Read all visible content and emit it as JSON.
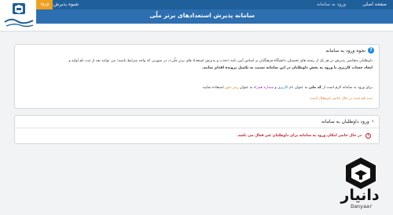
{
  "header": {
    "system_title": "سامانه پذیرش استعدادهای برتر ملّی",
    "nav": {
      "home": "صفحه اصلی",
      "register": "شیوه پذیرش",
      "other": "ورود به سامانه",
      "login": "ورود"
    }
  },
  "card1": {
    "title": "نحوه ورود به سامانه",
    "line1": "داوطلبان متقاضی پذیرش در هر یک از رشته های تحصیلی  دانشگاه فرهنگیان  بر اساس آیین نامه «جذب و پذیرش استعداد های برتر ملّی»، در صورتی که واجد شرایط باشند؛ می توانند بعد از ثبت نام  اولیه و",
    "line2": "ایجاد حساب کاربری با ورود به بخش داوطلبان در این سامانه نسبت به تکمیل پرونده اقدام نمایند.",
    "line3_a": "برای ورود به سامانه لازم است از ",
    "line3_b": "کد ملی",
    "line3_c": " به عنوان ",
    "line3_d": "نام کاربری",
    "line3_e": " و ",
    "line3_f": "شماره همراه",
    "line3_g": " به عنوان ",
    "line3_h": "رمز عبور",
    "line3_i": " استفاده نمایید.",
    "notice": "ثبت نام جدید در حال حاضر غیرفعال است"
  },
  "card2": {
    "title": "ورود داوطلبان به سامانه",
    "alert": "در حال حاضر امکان ورود به سامانه برای داوطلبان غیر فعال می باشد."
  },
  "watermark": {
    "brand": "دانیار",
    "sub": "Danyaar"
  }
}
